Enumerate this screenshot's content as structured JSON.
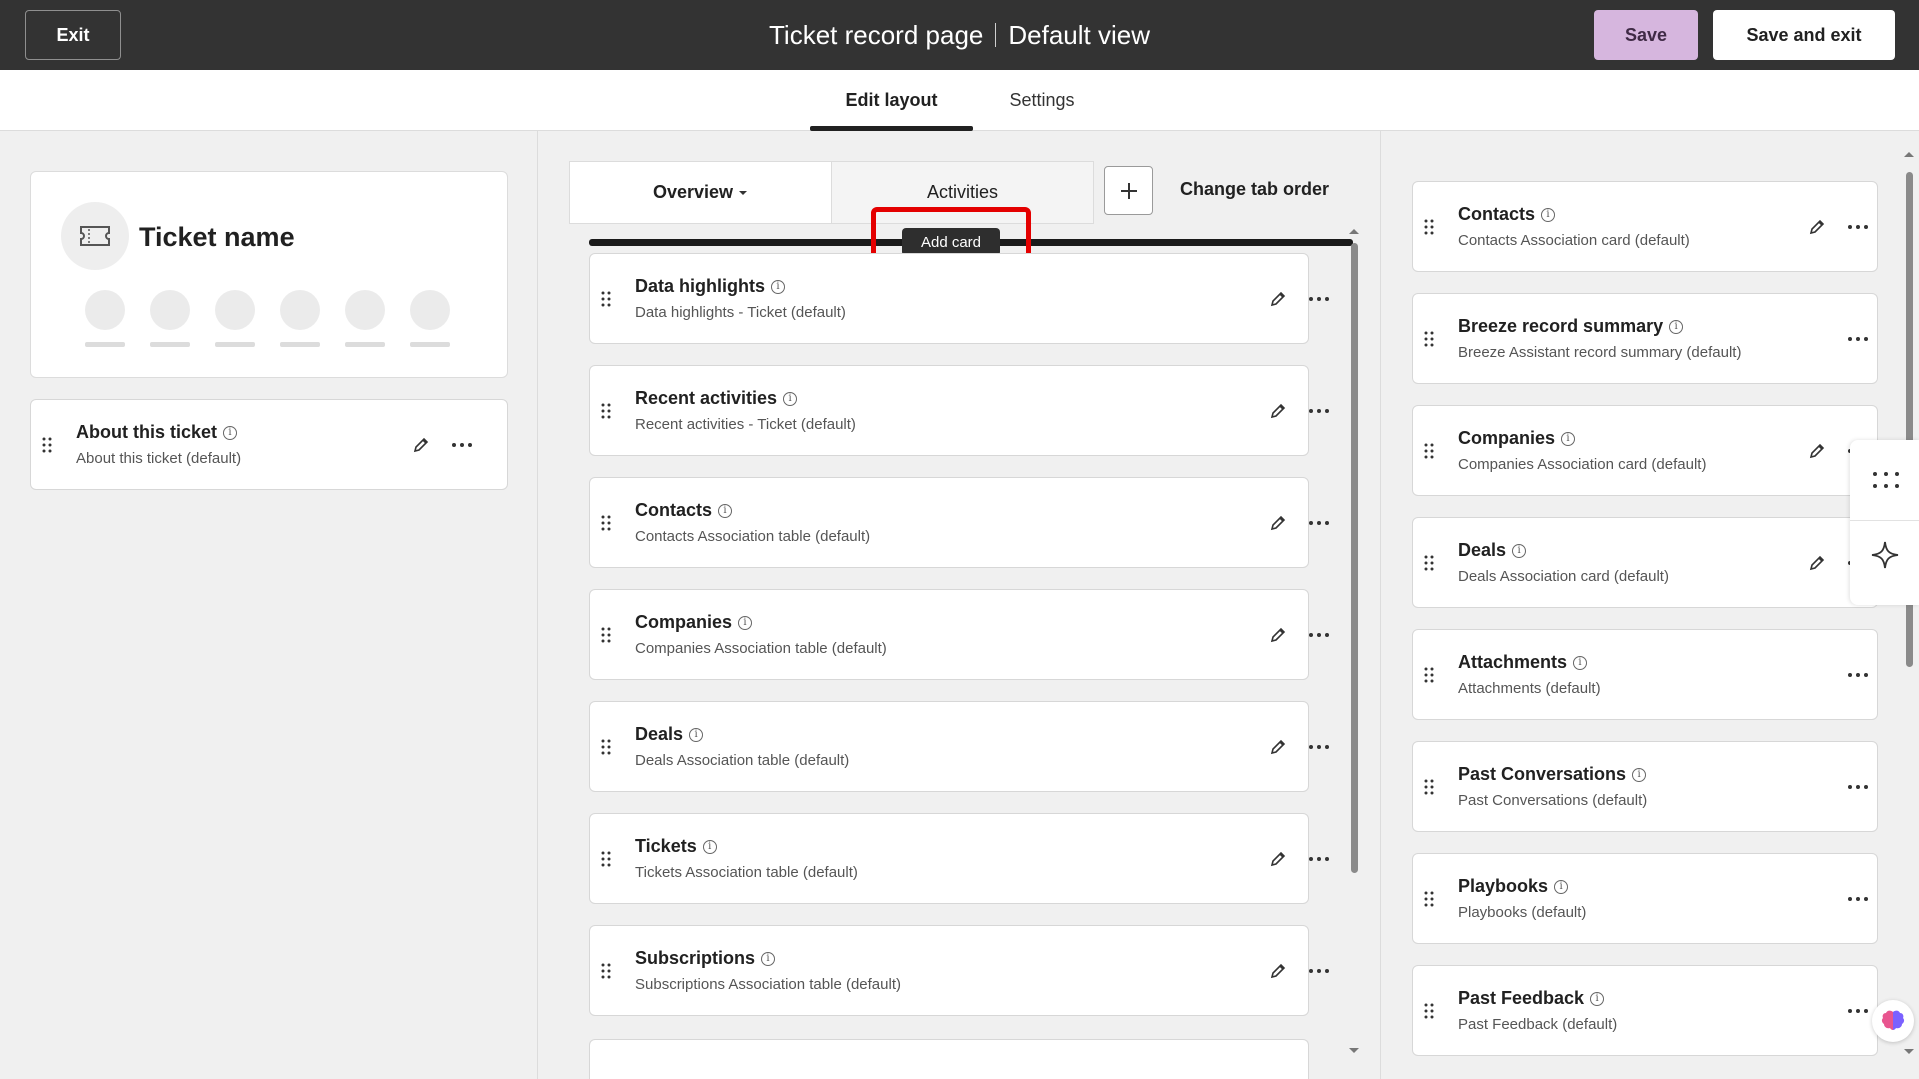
{
  "topbar": {
    "exit_label": "Exit",
    "title_record": "Ticket record page",
    "title_view": "Default view",
    "save_label": "Save",
    "save_exit_label": "Save and exit"
  },
  "main_tabs": [
    {
      "label": "Edit layout",
      "active": true
    },
    {
      "label": "Settings",
      "active": false
    }
  ],
  "left": {
    "ticket_name": "Ticket name",
    "about_card": {
      "title": "About this ticket",
      "subtitle": "About this ticket (default)"
    }
  },
  "middle": {
    "tabs": [
      {
        "label": "Overview",
        "active": true
      },
      {
        "label": "Activities",
        "active": false
      }
    ],
    "add_tab_icon": "plus-icon",
    "change_tab_order_label": "Change tab order",
    "tooltip": "Add card",
    "cards": [
      {
        "title": "Data highlights",
        "subtitle": "Data highlights - Ticket (default)"
      },
      {
        "title": "Recent activities",
        "subtitle": "Recent activities - Ticket (default)"
      },
      {
        "title": "Contacts",
        "subtitle": "Contacts Association table (default)"
      },
      {
        "title": "Companies",
        "subtitle": "Companies Association table (default)"
      },
      {
        "title": "Deals",
        "subtitle": "Deals Association table (default)"
      },
      {
        "title": "Tickets",
        "subtitle": "Tickets Association table (default)"
      },
      {
        "title": "Subscriptions",
        "subtitle": "Subscriptions Association table (default)"
      }
    ]
  },
  "right": {
    "cards": [
      {
        "title": "Contacts",
        "subtitle": "Contacts Association card (default)",
        "editable": true
      },
      {
        "title": "Breeze record summary",
        "subtitle": "Breeze Assistant record summary (default)",
        "editable": false
      },
      {
        "title": "Companies",
        "subtitle": "Companies Association card (default)",
        "editable": true
      },
      {
        "title": "Deals",
        "subtitle": "Deals Association card (default)",
        "editable": true
      },
      {
        "title": "Attachments",
        "subtitle": "Attachments (default)",
        "editable": false
      },
      {
        "title": "Past Conversations",
        "subtitle": "Past Conversations (default)",
        "editable": false
      },
      {
        "title": "Playbooks",
        "subtitle": "Playbooks (default)",
        "editable": false
      },
      {
        "title": "Past Feedback",
        "subtitle": "Past Feedback (default)",
        "editable": false
      }
    ]
  },
  "colors": {
    "topbar_bg": "#333333",
    "save_bg": "#d6b6de",
    "highlight": "#e40000",
    "panel_bg": "#f0f0f0"
  }
}
